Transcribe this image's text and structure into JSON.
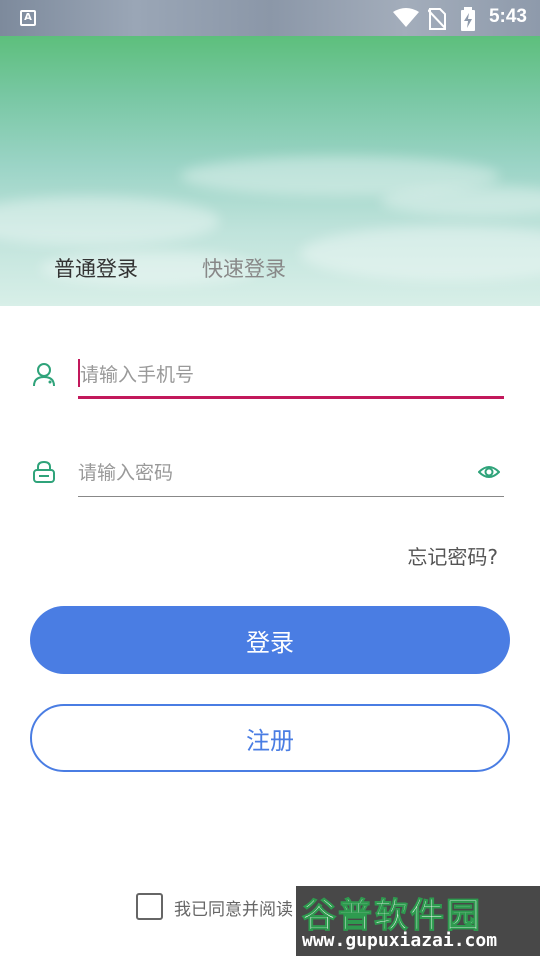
{
  "status_bar": {
    "app_icon_letter": "A",
    "time": "5:43",
    "icons": [
      "wifi-icon",
      "no-sim-icon",
      "battery-charging-icon"
    ]
  },
  "tabs": {
    "normal_login": "普通登录",
    "quick_login": "快速登录"
  },
  "form": {
    "phone_placeholder": "请输入手机号",
    "phone_value": "",
    "password_placeholder": "请输入密码",
    "password_value": "",
    "forgot_password": "忘记密码?"
  },
  "buttons": {
    "login": "登录",
    "register": "注册"
  },
  "agreement": {
    "text": "我已同意并阅读",
    "checked": false
  },
  "watermark": {
    "title": "谷普软件园",
    "url": "www.gupuxiazai.com"
  },
  "colors": {
    "primary": "#4a7de3",
    "accent_input": "#c2185b",
    "icon_green": "#2fa37a",
    "header_top": "#5dbf7c"
  }
}
